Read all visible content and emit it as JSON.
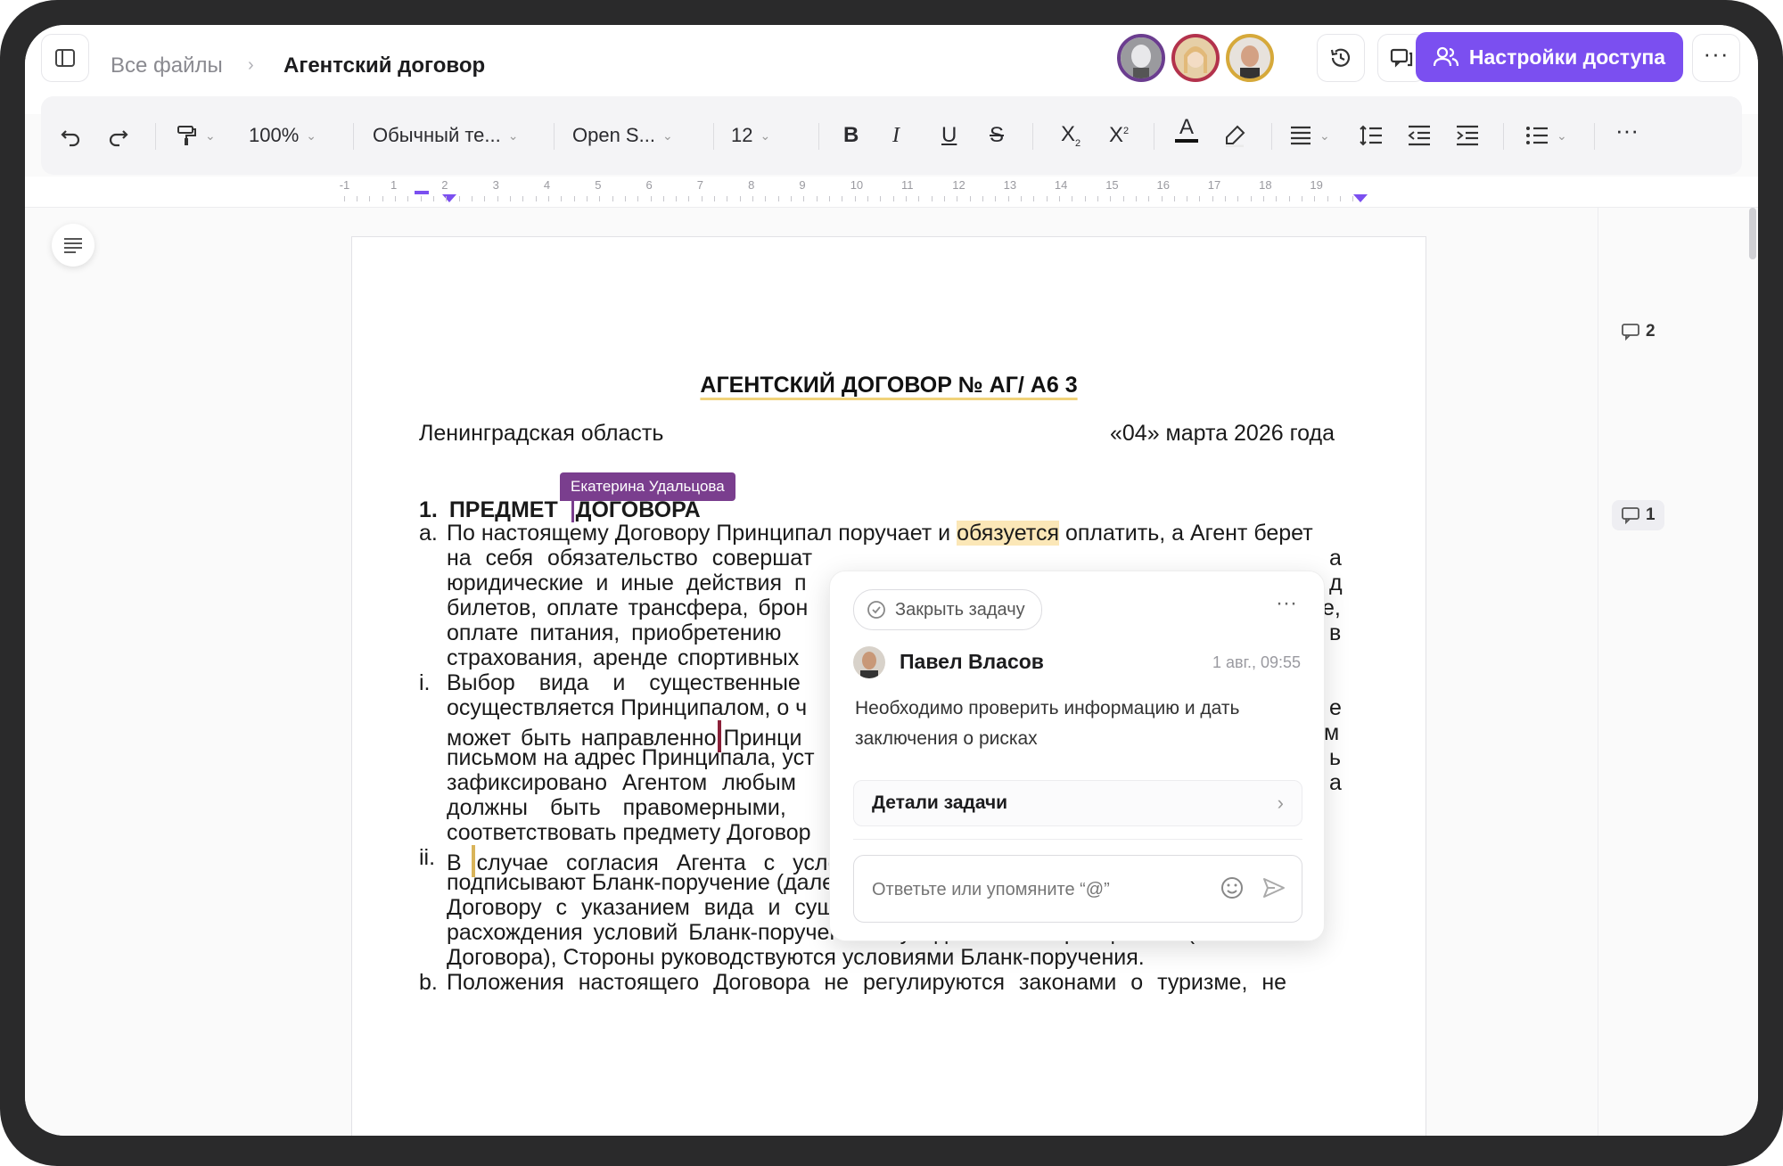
{
  "breadcrumbs": {
    "root": "Все файлы",
    "current": "Агентский договор"
  },
  "header": {
    "share_label": "Настройки доступа"
  },
  "toolbar": {
    "zoom": "100%",
    "style": "Обычный те...",
    "font": "Open S...",
    "size": "12"
  },
  "ruler": [
    "-1",
    "1",
    "2",
    "3",
    "4",
    "5",
    "6",
    "7",
    "8",
    "9",
    "10",
    "11",
    "12",
    "13",
    "14",
    "15",
    "16",
    "17",
    "18",
    "19"
  ],
  "document": {
    "title": "АГЕНТСКИЙ ДОГОВОР № АГ/ А6 3",
    "region": "Ленинградская область",
    "date": "«04» марта 2026 года",
    "section_num": "1.",
    "section_title_a": "ПРЕДМЕТ",
    "section_title_b": "ДОГОВОРА",
    "cursor_user": "Екатерина Удальцова",
    "item_a_marker": "a.",
    "item_a_line1_start": "По настоящему Договору Принципал поручает и",
    "item_a_line1_hl": "обязуется",
    "item_a_line1_end": "оплатить, а Агент берет",
    "item_a_line2_left": "на себя обязательство совершат",
    "item_a_line2_right": "а",
    "item_a_line3_left": "юридические и иные действия п",
    "item_a_line3_right": "д",
    "item_a_line4_left": "билетов, оплате трансфера, брон",
    "item_a_line4_right": "е,",
    "item_a_line5_left": "оплате питания,  приобретению",
    "item_a_line5_right": "в",
    "item_a_line6_left": "страхования,  аренде спортивных",
    "item_i_marker": "i.",
    "item_i_line1_left": "Выбор вида и существенные",
    "item_i_line2_left": "осуществляется Принципалом, о ч",
    "item_i_line2_right": "е",
    "item_i_line3_left": "может быть направленно",
    "item_i_line3_mid": "Принци",
    "item_i_line3_right": "м",
    "item_i_line4_left": "письмом на адрес Принципала, уст",
    "item_i_line4_right": "ь",
    "item_i_line5_left": "зафиксировано Агентом любым",
    "item_i_line5_right": "а",
    "item_i_line6_left": "должны быть правомерными,",
    "item_i_line7_left": "соответствовать предмету Договор",
    "item_ii_marker": "ii.",
    "item_ii_line1_a": "В",
    "item_ii_line1_b": "случае согласия Агента с условиями конкретного поручения, Стороны",
    "item_ii_line2": "подписывают Бланк-поручение (далее – Поручение) по форме приложения № 1 к",
    "item_ii_line3": "Договору с указанием вида и существенных условий поручения. В случае",
    "item_ii_line4": "расхождения условий Бланк-поручения и уведомления Принципала (п. 1.1.1.",
    "item_ii_line5": "Договора), Стороны руководствуются условиями Бланк-поручения.",
    "item_b_marker": "b.",
    "item_b_line1": "Положения настоящего Договора не регулируются  законами о туризме, не"
  },
  "comments": {
    "count_top": "2",
    "count_bottom": "1"
  },
  "popup": {
    "close_task": "Закрыть задачу",
    "author": "Павел Власов",
    "time": "1 авг., 09:55",
    "message_line1": "Необходимо проверить информацию и дать",
    "message_line2": "заключения о рисках",
    "details": "Детали задачи",
    "reply_placeholder": "Ответьте или упомяните “@”"
  },
  "colors": {
    "accent": "#7b4ff0",
    "highlight": "#fbe7b7",
    "cursor_purple": "#7a3e8e",
    "cursor_red": "#8b2038",
    "cursor_gold": "#d9b45a"
  }
}
